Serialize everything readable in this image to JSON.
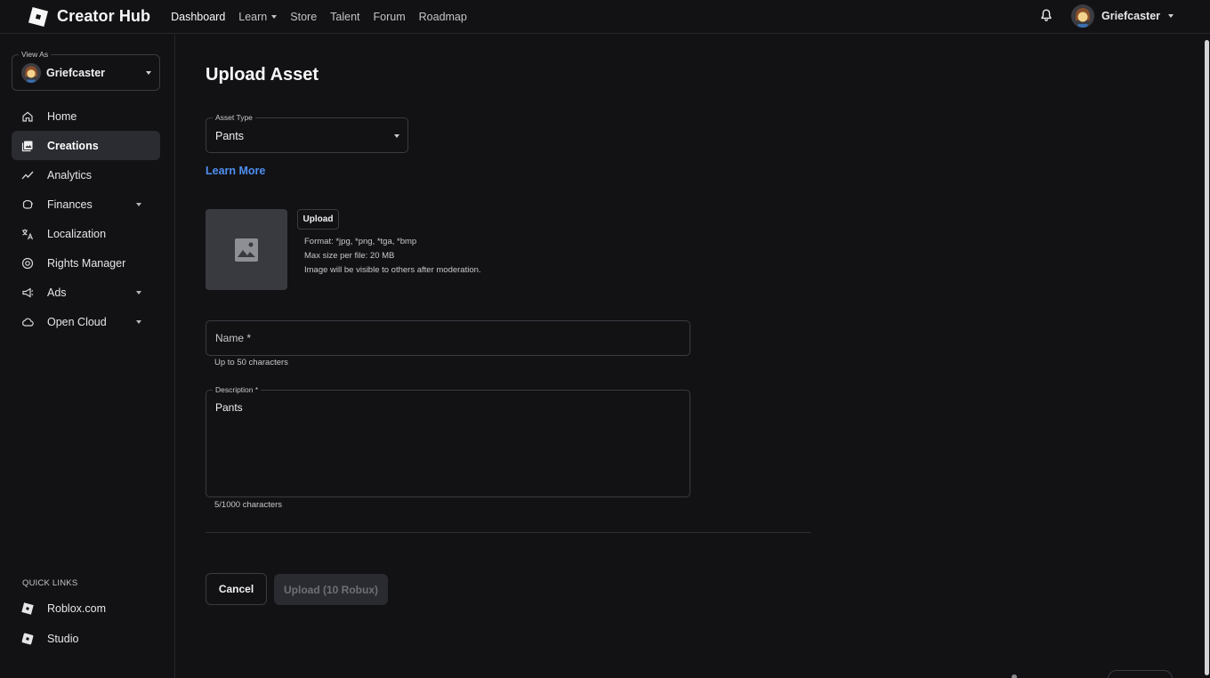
{
  "topbar": {
    "brand": "Creator Hub",
    "nav": [
      {
        "label": "Dashboard",
        "active": true,
        "dropdown": false
      },
      {
        "label": "Learn",
        "active": false,
        "dropdown": true
      },
      {
        "label": "Store",
        "active": false,
        "dropdown": false
      },
      {
        "label": "Talent",
        "active": false,
        "dropdown": false
      },
      {
        "label": "Forum",
        "active": false,
        "dropdown": false
      },
      {
        "label": "Roadmap",
        "active": false,
        "dropdown": false
      }
    ],
    "user_name": "Griefcaster",
    "icons": {
      "notifications": "bell-icon",
      "logo": "roblox-logo-icon"
    }
  },
  "sidebar": {
    "view_as_label": "View As",
    "view_as_name": "Griefcaster",
    "items": [
      {
        "label": "Home",
        "icon": "home-icon",
        "active": false,
        "dropdown": false
      },
      {
        "label": "Creations",
        "icon": "creations-icon",
        "active": true,
        "dropdown": false
      },
      {
        "label": "Analytics",
        "icon": "analytics-icon",
        "active": false,
        "dropdown": false
      },
      {
        "label": "Finances",
        "icon": "finances-icon",
        "active": false,
        "dropdown": true
      },
      {
        "label": "Localization",
        "icon": "translate-icon",
        "active": false,
        "dropdown": false
      },
      {
        "label": "Rights Manager",
        "icon": "copyright-icon",
        "active": false,
        "dropdown": false
      },
      {
        "label": "Ads",
        "icon": "megaphone-icon",
        "active": false,
        "dropdown": true
      },
      {
        "label": "Open Cloud",
        "icon": "cloud-icon",
        "active": false,
        "dropdown": true
      }
    ],
    "quick_links_title": "QUICK LINKS",
    "quick_links": [
      {
        "label": "Roblox.com",
        "icon": "roblox-icon"
      },
      {
        "label": "Studio",
        "icon": "studio-icon"
      }
    ]
  },
  "main": {
    "title": "Upload Asset",
    "asset_type": {
      "legend": "Asset Type",
      "value": "Pants"
    },
    "learn_more": "Learn More",
    "upload": {
      "button_label": "Upload",
      "info": [
        "Format: *jpg, *png, *tga, *bmp",
        "Max size per file: 20 MB",
        "Image will be visible to others after moderation."
      ]
    },
    "name_field": {
      "placeholder": "Name *",
      "value": "",
      "helper": "Up to 50 characters"
    },
    "description_field": {
      "legend": "Description *",
      "value": "Pants",
      "helper": "5/1000 characters"
    },
    "buttons": {
      "cancel": "Cancel",
      "submit": "Upload (10 Robux)"
    }
  },
  "colors": {
    "background": "#121215",
    "border": "#3a3b40",
    "active_item": "#2b2c31",
    "link": "#4f8ff0",
    "disabled_button": "#2a2b30"
  }
}
